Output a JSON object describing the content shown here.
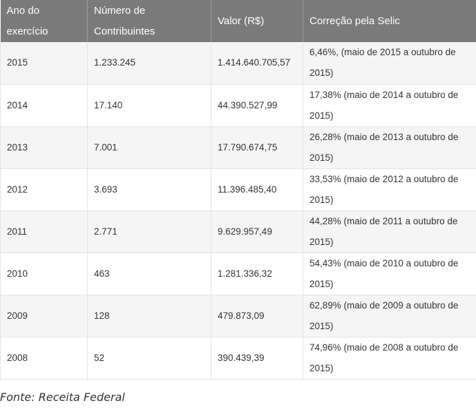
{
  "table": {
    "headers": [
      "Ano do exercício",
      "Número de Contribuintes",
      "Valor (R$)",
      "Correção pela Selic"
    ],
    "rows": [
      [
        "2015",
        "1.233.245",
        "1.414.640.705,57",
        "6,46%, (maio de 2015 a outubro de 2015)"
      ],
      [
        "2014",
        "17.140",
        "44.390.527,99",
        "17,38% (maio de 2014 a outubro de 2015)"
      ],
      [
        "2013",
        "7.001",
        "17.790.674,75",
        "26,28% (maio de 2013 a outubro de 2015)"
      ],
      [
        "2012",
        "3.693",
        "11.396.485,40",
        "33,53% (maio de 2012 a outubro de 2015)"
      ],
      [
        "2011",
        "2.771",
        "9.629.957,49",
        "44,28% (maio de 2011 a outubro de 2015)"
      ],
      [
        "2010",
        "463",
        "1.281.336,32",
        "54,43% (maio de 2010 a outubro de 2015)"
      ],
      [
        "2009",
        "128",
        "479.873,09",
        "62,89% (maio de 2009 a outubro de 2015)"
      ],
      [
        "2008",
        "52",
        "390.439,39",
        "74,96% (maio de 2008 a outubro de 2015)"
      ]
    ]
  },
  "source": "Fonte: Receita Federal",
  "colors": {
    "header_bg": "#7a7a7a",
    "header_text": "#ffffff",
    "row_alt_bg": "#f5f5f5",
    "border": "#e3e3e3"
  }
}
